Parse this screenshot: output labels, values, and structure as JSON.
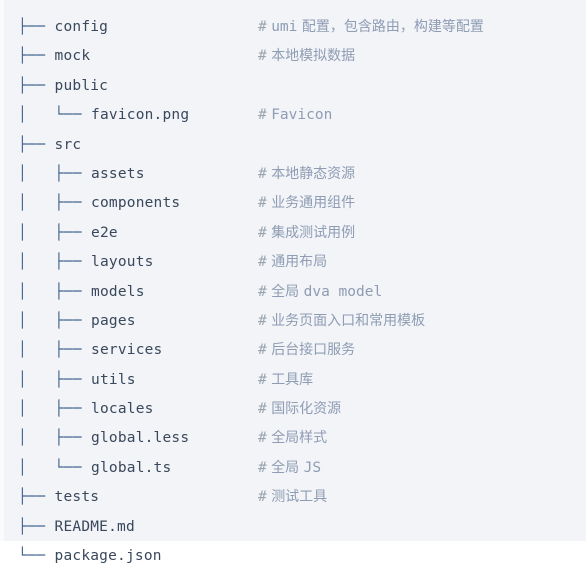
{
  "panel": {
    "kind": "directory-tree-listing",
    "background_color": "#f2f4f7",
    "glyph_color": "#42648f",
    "name_color": "#39485c",
    "hash_color": "#9aa4ae",
    "comment_color": "#8e9cb4"
  },
  "rows": [
    {
      "glyph": "├── ",
      "name": "config",
      "hash": "#",
      "comment_pre": " ",
      "comment_mono": "umi",
      "comment_post": " 配置，包含路由，构建等配置"
    },
    {
      "glyph": "├── ",
      "name": "mock",
      "hash": "#",
      "comment_pre": " ",
      "comment_mono": "",
      "comment_post": "本地模拟数据"
    },
    {
      "glyph": "├── ",
      "name": "public",
      "hash": "",
      "comment_pre": "",
      "comment_mono": "",
      "comment_post": ""
    },
    {
      "glyph": "│   └── ",
      "name": "favicon.png",
      "hash": "#",
      "comment_pre": " ",
      "comment_mono": "Favicon",
      "comment_post": ""
    },
    {
      "glyph": "├── ",
      "name": "src",
      "hash": "",
      "comment_pre": "",
      "comment_mono": "",
      "comment_post": ""
    },
    {
      "glyph": "│   ├── ",
      "name": "assets",
      "hash": "#",
      "comment_pre": " ",
      "comment_mono": "",
      "comment_post": "本地静态资源"
    },
    {
      "glyph": "│   ├── ",
      "name": "components",
      "hash": "#",
      "comment_pre": " ",
      "comment_mono": "",
      "comment_post": "业务通用组件"
    },
    {
      "glyph": "│   ├── ",
      "name": "e2e",
      "hash": "#",
      "comment_pre": " ",
      "comment_mono": "",
      "comment_post": "集成测试用例"
    },
    {
      "glyph": "│   ├── ",
      "name": "layouts",
      "hash": "#",
      "comment_pre": " ",
      "comment_mono": "",
      "comment_post": "通用布局"
    },
    {
      "glyph": "│   ├── ",
      "name": "models",
      "hash": "#",
      "comment_pre": " 全局 ",
      "comment_mono": "dva model",
      "comment_post": ""
    },
    {
      "glyph": "│   ├── ",
      "name": "pages",
      "hash": "#",
      "comment_pre": " ",
      "comment_mono": "",
      "comment_post": "业务页面入口和常用模板"
    },
    {
      "glyph": "│   ├── ",
      "name": "services",
      "hash": "#",
      "comment_pre": " ",
      "comment_mono": "",
      "comment_post": "后台接口服务"
    },
    {
      "glyph": "│   ├── ",
      "name": "utils",
      "hash": "#",
      "comment_pre": " ",
      "comment_mono": "",
      "comment_post": "工具库"
    },
    {
      "glyph": "│   ├── ",
      "name": "locales",
      "hash": "#",
      "comment_pre": " ",
      "comment_mono": "",
      "comment_post": "国际化资源"
    },
    {
      "glyph": "│   ├── ",
      "name": "global.less",
      "hash": "#",
      "comment_pre": " ",
      "comment_mono": "",
      "comment_post": "全局样式"
    },
    {
      "glyph": "│   └── ",
      "name": "global.ts",
      "hash": "#",
      "comment_pre": " 全局 ",
      "comment_mono": "JS",
      "comment_post": ""
    },
    {
      "glyph": "├── ",
      "name": "tests",
      "hash": "#",
      "comment_pre": " ",
      "comment_mono": "",
      "comment_post": "测试工具"
    },
    {
      "glyph": "├── ",
      "name": "README.md",
      "hash": "",
      "comment_pre": "",
      "comment_mono": "",
      "comment_post": ""
    },
    {
      "glyph": "└── ",
      "name": "package.json",
      "hash": "",
      "comment_pre": "",
      "comment_mono": "",
      "comment_post": ""
    }
  ]
}
